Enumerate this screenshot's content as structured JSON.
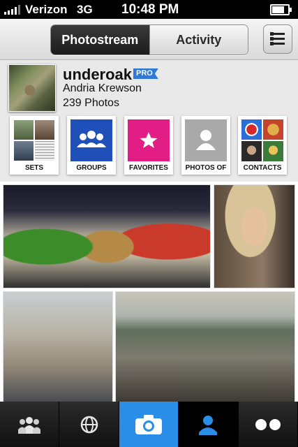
{
  "status_bar": {
    "carrier": "Verizon",
    "network": "3G",
    "time": "10:48 PM",
    "battery_level": 0.85
  },
  "navbar": {
    "tabs": [
      {
        "label": "Photostream",
        "selected": true
      },
      {
        "label": "Activity",
        "selected": false
      }
    ],
    "menu_icon": "list-icon"
  },
  "profile": {
    "username": "underoak",
    "badge": "PRO",
    "real_name": "Andria Krewson",
    "photo_count": "239 Photos"
  },
  "collections": [
    {
      "label": "SETS",
      "icon": "sets-thumbnails"
    },
    {
      "label": "GROUPS",
      "icon": "groups-icon",
      "color": "#1f4fb9"
    },
    {
      "label": "FAVORITES",
      "icon": "star-icon",
      "color": "#e21d86"
    },
    {
      "label": "PHOTOS OF",
      "icon": "person-icon",
      "color": "#a9a9a9"
    },
    {
      "label": "CONTACTS",
      "icon": "contacts-thumbnails"
    }
  ],
  "tab_bar": [
    {
      "name": "contacts-tab",
      "icon": "people-icon"
    },
    {
      "name": "explore-tab",
      "icon": "globe-icon"
    },
    {
      "name": "camera-tab",
      "icon": "camera-icon",
      "color": "#2a8de8"
    },
    {
      "name": "profile-tab",
      "icon": "person-icon",
      "color": "#2a8de8"
    },
    {
      "name": "more-tab",
      "icon": "flickr-dots-icon"
    }
  ]
}
